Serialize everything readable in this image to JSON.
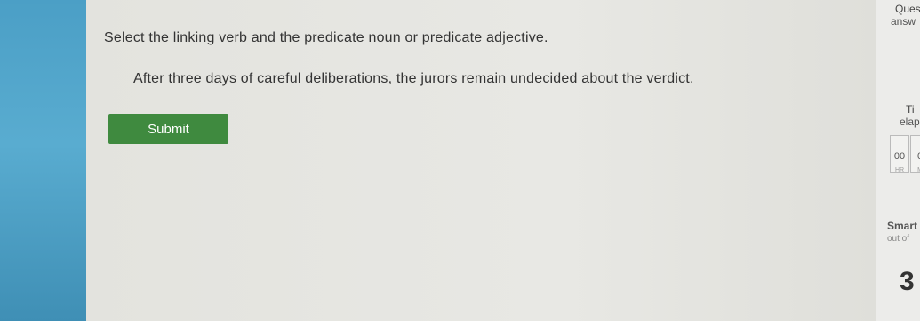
{
  "question": {
    "instruction": "Select the linking verb and the predicate noun or predicate adjective.",
    "sentence": "After three days of careful deliberations, the jurors remain undecided about the verdict.",
    "submit_label": "Submit"
  },
  "sidebar": {
    "questions_title": "Ques",
    "questions_sub": "answ",
    "questions_answered_count": "",
    "time_title": "Ti",
    "time_sub": "elap",
    "timer_hours": "00",
    "timer_hours_unit": "HR",
    "timer_minutes": "0",
    "timer_minutes_unit": "M",
    "smartscore_title": "Smart",
    "smartscore_sub": "out of",
    "smartscore_value": "3"
  },
  "colors": {
    "left_bar": "#4b9fc6",
    "submit_button": "#3f8a3f",
    "background": "#e3e3de"
  }
}
